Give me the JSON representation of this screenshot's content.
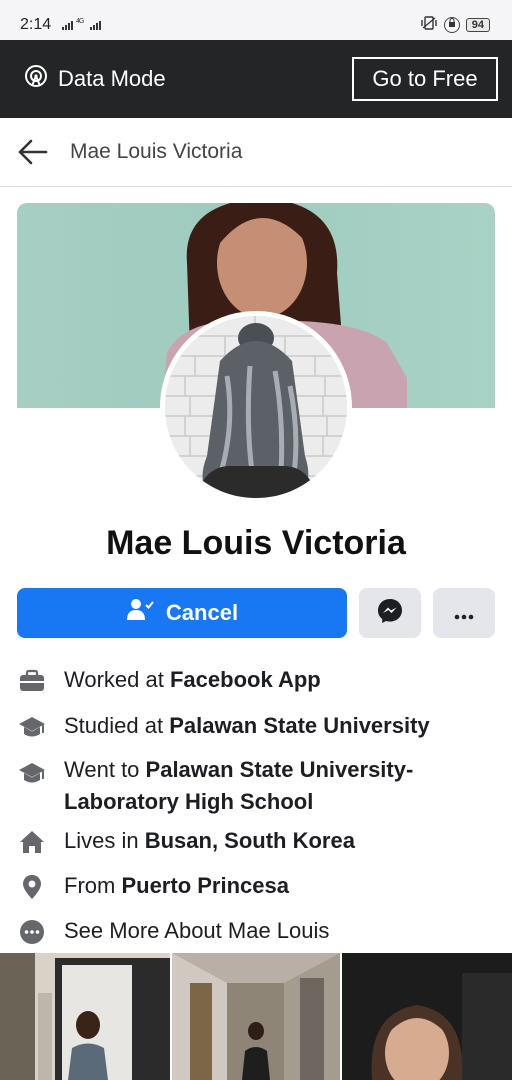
{
  "status_bar": {
    "time": "2:14",
    "signal": "4G",
    "battery": "94"
  },
  "banner": {
    "data_mode_label": "Data Mode",
    "go_free_label": "Go to Free"
  },
  "header": {
    "title": "Mae Louis Victoria"
  },
  "profile": {
    "name": "Mae Louis Victoria"
  },
  "actions": {
    "cancel_label": "Cancel"
  },
  "details": [
    {
      "icon": "briefcase-icon",
      "prefix": "Worked at ",
      "bold": "Facebook App",
      "suffix": ""
    },
    {
      "icon": "graduation-cap-icon",
      "prefix": "Studied at ",
      "bold": "Palawan State University",
      "suffix": ""
    },
    {
      "icon": "graduation-cap-icon",
      "prefix": "Went to ",
      "bold": "Palawan State University-Laboratory High School",
      "suffix": ""
    },
    {
      "icon": "home-icon",
      "prefix": "Lives in ",
      "bold": "Busan, South Korea",
      "suffix": ""
    },
    {
      "icon": "location-pin-icon",
      "prefix": "From ",
      "bold": "Puerto Princesa",
      "suffix": ""
    },
    {
      "icon": "more-dots-icon",
      "prefix": "See More About Mae Louis",
      "bold": "",
      "suffix": ""
    }
  ],
  "colors": {
    "accent": "#1877f2",
    "banner_bg": "#242526",
    "secondary_button": "#e4e6eb"
  }
}
